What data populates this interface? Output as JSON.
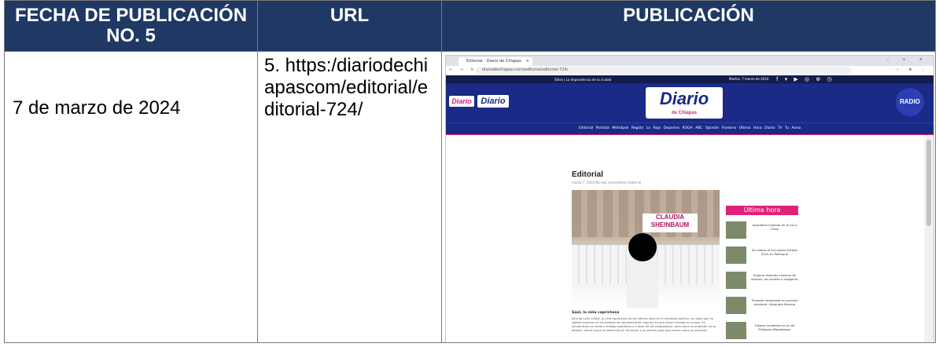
{
  "table": {
    "headers": [
      "FECHA DE PUBLICACIÓN NO. 5",
      "URL",
      "PUBLICACIÓN"
    ],
    "date": "7 de marzo de 2024",
    "url": "5. https:/diariodechiapascom/editorial/editorial-724/"
  },
  "screenshot": {
    "tab_title": "Editorial - Diario de Chiapas",
    "url": "diariodechiapas.com/editorial/editorial-724/",
    "top_left": "Sitios   |   La dependencia de la ciudad",
    "top_date": "Martes, 7 marzo de 2024",
    "social": "f ▾ ▶ ◎ ⊕ ◷",
    "logo_small": "Diario",
    "logo_mid": "Diario",
    "logo_center": "Diario",
    "logo_center_sub": "de Chiapas",
    "radio": "RADIO",
    "menu": "Editorial   Portada   Metrópoli   Región   La Roja   Deportes   ROGA   ABC   Opinión   Frontera   Última Hora   Diario TV   Tu Aviso",
    "article_title": "Editorial",
    "article_meta": "marzo 7, 2024   No hay comentarios   Editorial",
    "photo_banner": "CLAUDIA SHEINBAUM",
    "caption": "Saúl, la niña caprichosa",
    "body": "Saúl de León Villard, la niña caprichosa de los últimos años en el ambiente político, sin duda que ha sabido moverse en los puestos de representación popular en que mejor Chiapas lo conoce. Su actuamiento se limita a trabajo legislativo y a favor de los chiapanecos, pero como su ambición no se detiene, ahora busca la reelección en renunciar a su escaño para que asuma como su suplente.",
    "ultima_hora": "Última hora",
    "news": [
      "Aparatoso impacto en la vía a Costa",
      "Se realiza el Encuentro Estatal 2024 en Palenque",
      "Expone diversas carteras de artistas: las sendes e imágenes",
      "Promete integridad en proceso electoral: Alejandro Moreno",
      "Trágico accidente en la vía Pijijiapan-Mapastepec"
    ]
  }
}
